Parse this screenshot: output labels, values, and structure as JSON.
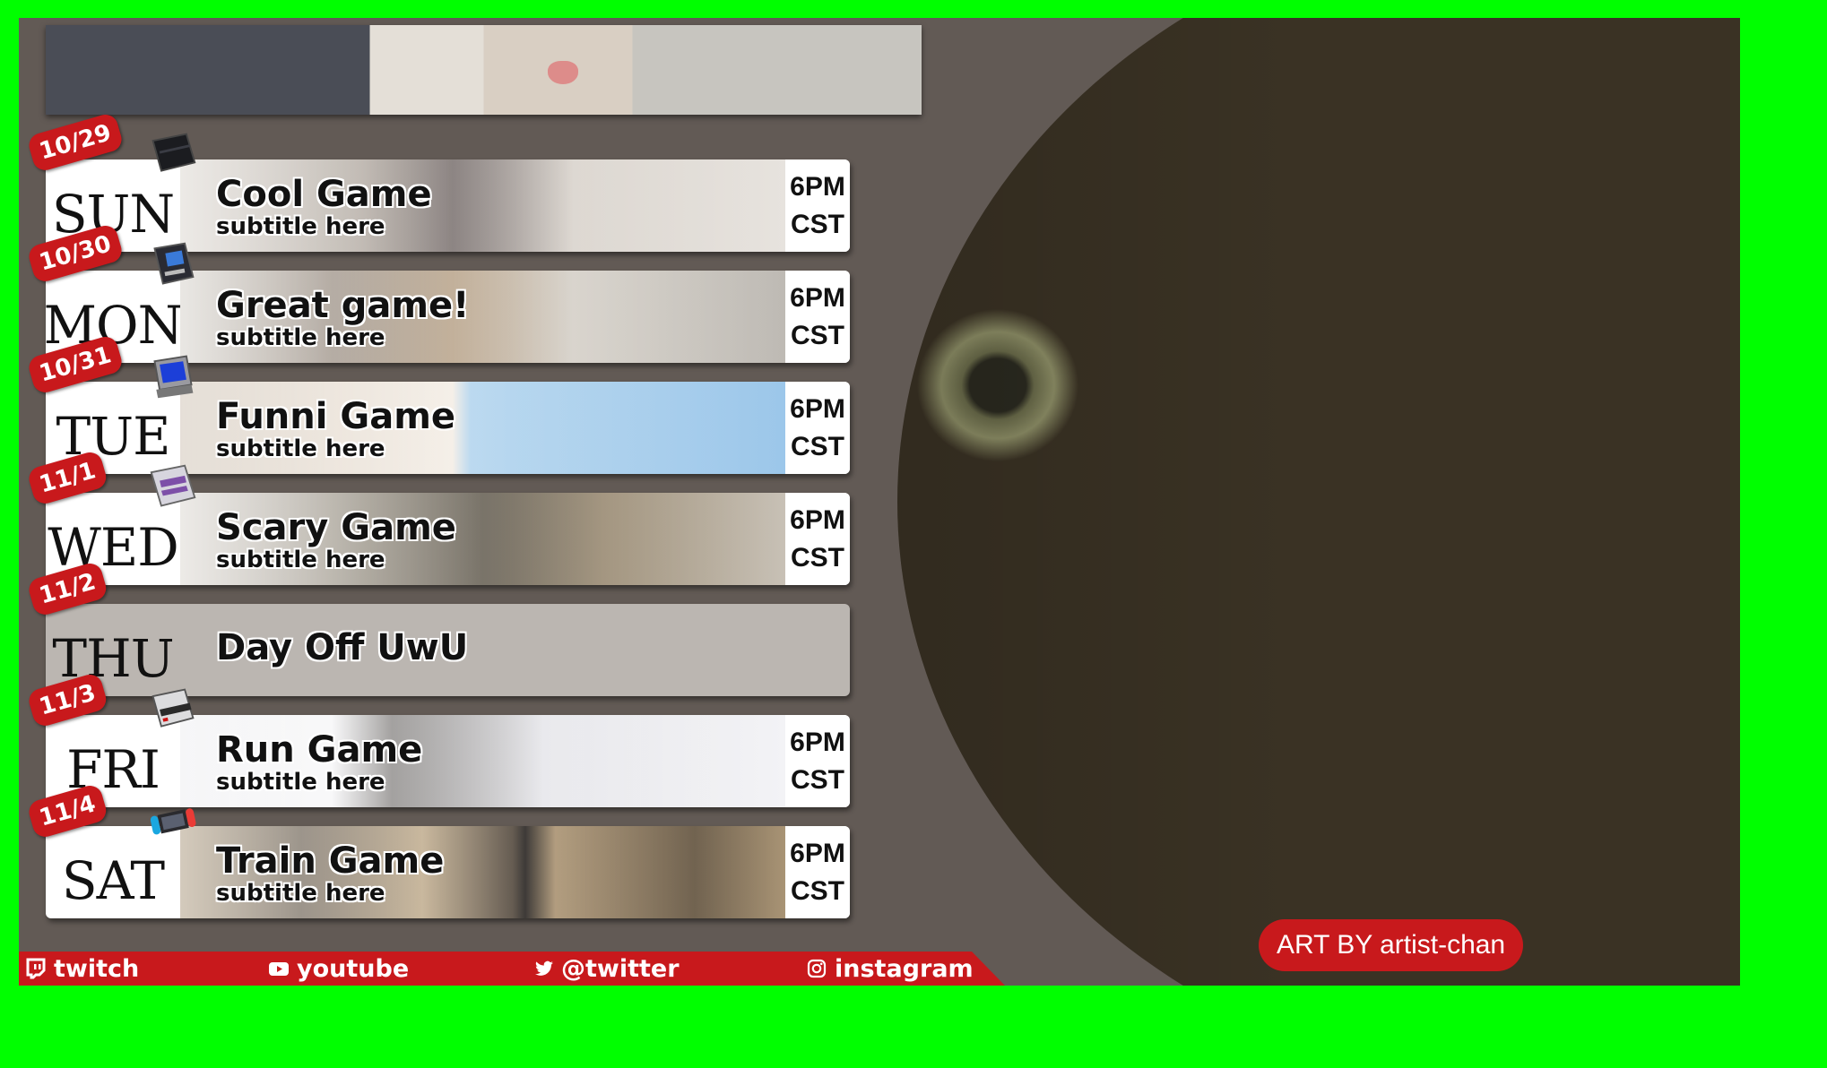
{
  "schedule": [
    {
      "date": "10/29",
      "day": "SUN",
      "title": "Cool Game",
      "subtitle": "subtitle here",
      "time1": "6PM",
      "time2": "CST",
      "console_icon": "ps2-console-icon"
    },
    {
      "date": "10/30",
      "day": "MON",
      "title": "Great game!",
      "subtitle": "subtitle here",
      "time1": "6PM",
      "time2": "CST",
      "console_icon": "arcade-cabinet-icon"
    },
    {
      "date": "10/31",
      "day": "TUE",
      "title": "Funni Game",
      "subtitle": "subtitle here",
      "time1": "6PM",
      "time2": "CST",
      "console_icon": "retro-computer-icon"
    },
    {
      "date": "11/1",
      "day": "WED",
      "title": "Scary Game",
      "subtitle": "subtitle here",
      "time1": "6PM",
      "time2": "CST",
      "console_icon": "snes-console-icon"
    },
    {
      "date": "11/2",
      "day": "THU",
      "title": "Day Off UwU"
    },
    {
      "date": "11/3",
      "day": "FRI",
      "title": "Run Game",
      "subtitle": "subtitle here",
      "time1": "6PM",
      "time2": "CST",
      "console_icon": "nes-console-icon"
    },
    {
      "date": "11/4",
      "day": "SAT",
      "title": "Train Game",
      "subtitle": "subtitle here",
      "time1": "6PM",
      "time2": "CST",
      "console_icon": "switch-console-icon"
    }
  ],
  "socials": {
    "twitch": "twitch",
    "youtube": "youtube",
    "twitter": "@twitter",
    "instagram": "instagram"
  },
  "credit": "ART BY artist-chan",
  "colors": {
    "chroma_green": "#00ff00",
    "panel": "#625a55",
    "accent_red": "#c8191c",
    "off_row": "#bbb6b1"
  }
}
